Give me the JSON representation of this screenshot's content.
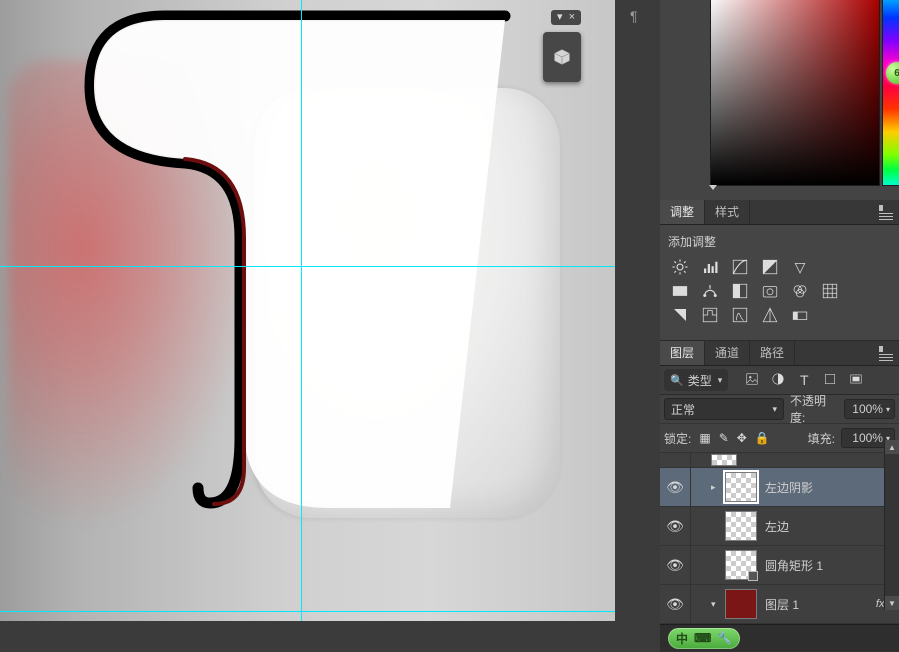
{
  "widget3d": {
    "submenu_glyph": "▾",
    "close_glyph": "×"
  },
  "badge60": "6",
  "panels": {
    "adjust": {
      "tabs": [
        "调整",
        "样式"
      ],
      "active_tab_index": 0,
      "title": "添加调整"
    },
    "layers": {
      "tabs": [
        "图层",
        "通道",
        "路径"
      ],
      "active_tab_index": 0,
      "filter_label": "类型",
      "blend_mode": "正常",
      "opacity_label": "不透明度:",
      "opacity_value": "100%",
      "lock_label": "锁定:",
      "fill_label": "填充:",
      "fill_value": "100%",
      "layers": [
        {
          "name": "左边阴影",
          "selected": true,
          "visible": true,
          "indent": 1,
          "twirl": false,
          "thumb": "checker_border"
        },
        {
          "name": "左边",
          "selected": false,
          "visible": true,
          "indent": 1,
          "twirl": false,
          "thumb": "checker"
        },
        {
          "name": "圆角矩形 1",
          "selected": false,
          "visible": true,
          "indent": 1,
          "twirl": false,
          "thumb": "checker_shape"
        },
        {
          "name": "图层 1",
          "selected": false,
          "visible": true,
          "indent": 1,
          "twirl": true,
          "thumb": "red",
          "fx": "fx"
        }
      ],
      "status_text": "中"
    }
  }
}
